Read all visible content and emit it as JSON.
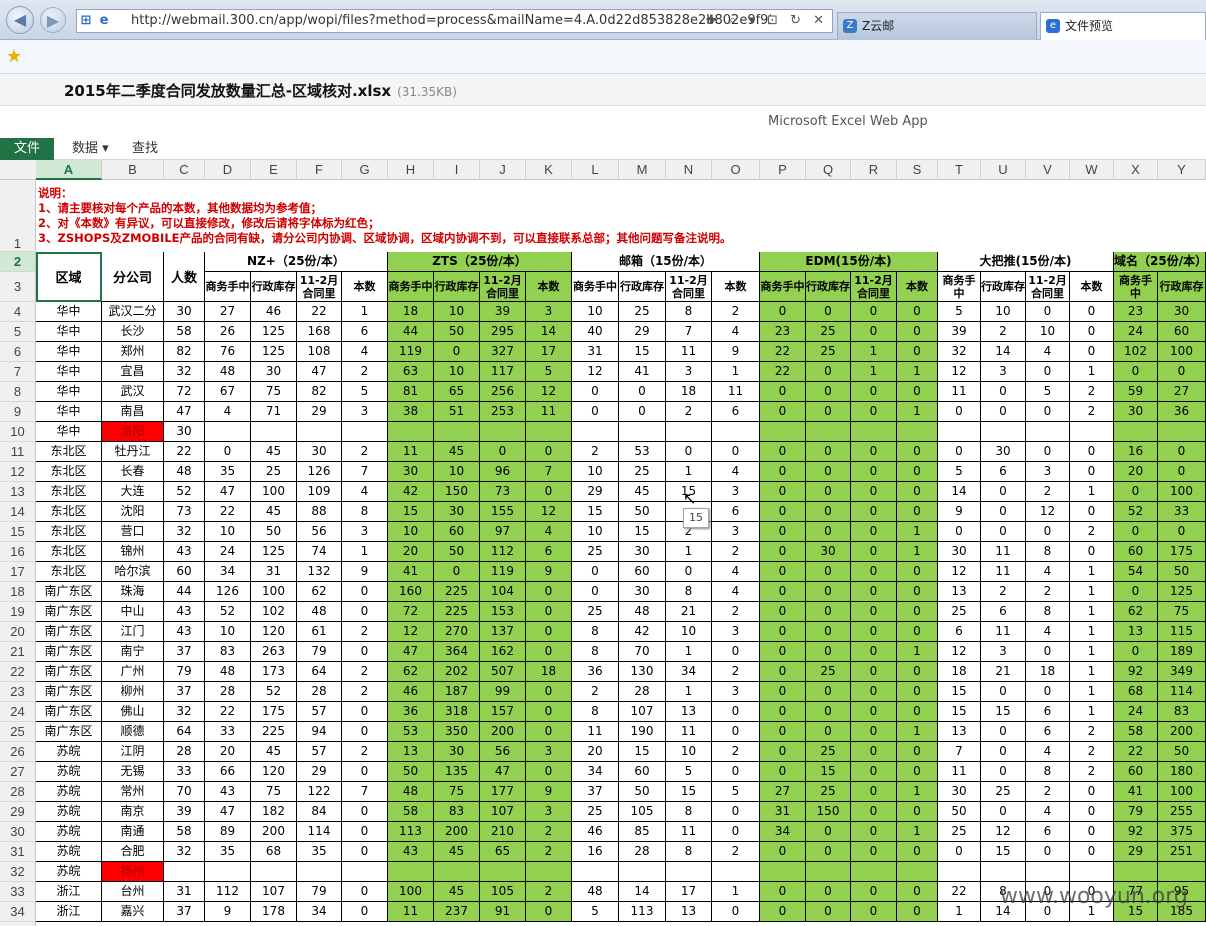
{
  "browser": {
    "back_glyph": "◀",
    "forward_glyph": "▶",
    "url": "http://webmail.300.cn/app/wopi/files?method=process&mailName=4.A.0d22d853828e2b802e9f93a95",
    "addr_tools": "✚ ⌕ ▾ ⊡ ↻ ✕",
    "tabs": [
      {
        "title": "Z云邮",
        "icon": "Z"
      },
      {
        "title": "文件预览",
        "icon": "e"
      }
    ],
    "favorites_icon": "★"
  },
  "file": {
    "name": "2015年二季度合同发放数量汇总-区域核对.xlsx",
    "size": "(31.35KB)"
  },
  "app": {
    "name": "Microsoft Excel Web App",
    "menu": {
      "file": "文件",
      "data": "数据 ▾",
      "find": "查找"
    }
  },
  "sheet": {
    "columns": [
      "A",
      "B",
      "C",
      "D",
      "E",
      "F",
      "G",
      "H",
      "I",
      "J",
      "K",
      "L",
      "M",
      "N",
      "O",
      "P",
      "Q",
      "R",
      "S",
      "T",
      "U",
      "V",
      "W",
      "X",
      "Y"
    ],
    "rows": [
      "1",
      "2",
      "3",
      "4",
      "5",
      "6",
      "7",
      "8",
      "9",
      "10",
      "11",
      "12",
      "13",
      "14",
      "15",
      "16",
      "17",
      "18",
      "19",
      "20",
      "21",
      "22",
      "23",
      "24",
      "25",
      "26",
      "27",
      "28",
      "29",
      "30",
      "31",
      "32",
      "33",
      "34"
    ],
    "notes": [
      "说明：",
      "1、请主要核对每个产品的本数，其他数据均为参考值；",
      "2、对《本数》有异议，可以直接修改，修改后请将字体标为红色；",
      "3、ZSHOPS及ZMOBILE产品的合同有缺，请分公司内协调、区域协调，区域内协调不到，可以直接联系总部；其他问题写备注说明。"
    ],
    "header": {
      "region": "区域",
      "branch": "分公司",
      "people": "人数",
      "groups": [
        "NZ+（25份/本）",
        "ZTS（25份/本）",
        "邮箱（15份/本）",
        "EDM(15份/本)",
        "大把推(15份/本)",
        "域名（25份/本）"
      ],
      "sub": [
        "商务手中",
        "行政库存",
        "11-2月合同里",
        "本数"
      ]
    },
    "data": [
      [
        "华中",
        "武汉二分",
        "30",
        "27",
        "46",
        "22",
        "1",
        "18",
        "10",
        "39",
        "3",
        "10",
        "25",
        "8",
        "2",
        "0",
        "0",
        "0",
        "0",
        "5",
        "10",
        "0",
        "0",
        "23",
        "30"
      ],
      [
        "华中",
        "长沙",
        "58",
        "26",
        "125",
        "168",
        "6",
        "44",
        "50",
        "295",
        "14",
        "40",
        "29",
        "7",
        "4",
        "23",
        "25",
        "0",
        "0",
        "39",
        "2",
        "10",
        "0",
        "24",
        "60"
      ],
      [
        "华中",
        "郑州",
        "82",
        "76",
        "125",
        "108",
        "4",
        "119",
        "0",
        "327",
        "17",
        "31",
        "15",
        "11",
        "9",
        "22",
        "25",
        "1",
        "0",
        "32",
        "14",
        "4",
        "0",
        "102",
        "100"
      ],
      [
        "华中",
        "宜昌",
        "32",
        "48",
        "30",
        "47",
        "2",
        "63",
        "10",
        "117",
        "5",
        "12",
        "41",
        "3",
        "1",
        "22",
        "0",
        "1",
        "1",
        "12",
        "3",
        "0",
        "1",
        "0",
        "0"
      ],
      [
        "华中",
        "武汉",
        "72",
        "67",
        "75",
        "82",
        "5",
        "81",
        "65",
        "256",
        "12",
        "0",
        "0",
        "18",
        "11",
        "0",
        "0",
        "0",
        "0",
        "11",
        "0",
        "5",
        "2",
        "59",
        "27"
      ],
      [
        "华中",
        "南昌",
        "47",
        "4",
        "71",
        "29",
        "3",
        "38",
        "51",
        "253",
        "11",
        "0",
        "0",
        "2",
        "6",
        "0",
        "0",
        "0",
        "1",
        "0",
        "0",
        "0",
        "2",
        "30",
        "36"
      ],
      [
        "华中",
        "洛阳",
        "30",
        "",
        "",
        "",
        "",
        "",
        "",
        "",
        "",
        "",
        "",
        "",
        "",
        "",
        "",
        "",
        "",
        "",
        "",
        "",
        "",
        "",
        ""
      ],
      [
        "东北区",
        "牡丹江",
        "22",
        "0",
        "45",
        "30",
        "2",
        "11",
        "45",
        "0",
        "0",
        "2",
        "53",
        "0",
        "0",
        "0",
        "0",
        "0",
        "0",
        "0",
        "30",
        "0",
        "0",
        "16",
        "0"
      ],
      [
        "东北区",
        "长春",
        "48",
        "35",
        "25",
        "126",
        "7",
        "30",
        "10",
        "96",
        "7",
        "10",
        "25",
        "1",
        "4",
        "0",
        "0",
        "0",
        "0",
        "5",
        "6",
        "3",
        "0",
        "20",
        "0"
      ],
      [
        "东北区",
        "大连",
        "52",
        "47",
        "100",
        "109",
        "4",
        "42",
        "150",
        "73",
        "0",
        "29",
        "45",
        "15",
        "3",
        "0",
        "0",
        "0",
        "0",
        "14",
        "0",
        "2",
        "1",
        "0",
        "100"
      ],
      [
        "东北区",
        "沈阳",
        "73",
        "22",
        "45",
        "88",
        "8",
        "15",
        "30",
        "155",
        "12",
        "15",
        "50",
        "",
        "6",
        "0",
        "0",
        "0",
        "0",
        "9",
        "0",
        "12",
        "0",
        "52",
        "33"
      ],
      [
        "东北区",
        "营口",
        "32",
        "10",
        "50",
        "56",
        "3",
        "10",
        "60",
        "97",
        "4",
        "10",
        "15",
        "2",
        "3",
        "0",
        "0",
        "0",
        "1",
        "0",
        "0",
        "0",
        "2",
        "0",
        "0"
      ],
      [
        "东北区",
        "锦州",
        "43",
        "24",
        "125",
        "74",
        "1",
        "20",
        "50",
        "112",
        "6",
        "25",
        "30",
        "1",
        "2",
        "0",
        "30",
        "0",
        "1",
        "30",
        "11",
        "8",
        "0",
        "60",
        "175"
      ],
      [
        "东北区",
        "哈尔滨",
        "60",
        "34",
        "31",
        "132",
        "9",
        "41",
        "0",
        "119",
        "9",
        "0",
        "60",
        "0",
        "4",
        "0",
        "0",
        "0",
        "0",
        "12",
        "11",
        "4",
        "1",
        "54",
        "50"
      ],
      [
        "南广东区",
        "珠海",
        "44",
        "126",
        "100",
        "62",
        "0",
        "160",
        "225",
        "104",
        "0",
        "0",
        "30",
        "8",
        "4",
        "0",
        "0",
        "0",
        "0",
        "13",
        "2",
        "2",
        "1",
        "0",
        "125"
      ],
      [
        "南广东区",
        "中山",
        "43",
        "52",
        "102",
        "48",
        "0",
        "72",
        "225",
        "153",
        "0",
        "25",
        "48",
        "21",
        "2",
        "0",
        "0",
        "0",
        "0",
        "25",
        "6",
        "8",
        "1",
        "62",
        "75"
      ],
      [
        "南广东区",
        "江门",
        "43",
        "10",
        "120",
        "61",
        "2",
        "12",
        "270",
        "137",
        "0",
        "8",
        "42",
        "10",
        "3",
        "0",
        "0",
        "0",
        "0",
        "6",
        "11",
        "4",
        "1",
        "13",
        "115"
      ],
      [
        "南广东区",
        "南宁",
        "37",
        "83",
        "263",
        "79",
        "0",
        "47",
        "364",
        "162",
        "0",
        "8",
        "70",
        "1",
        "0",
        "0",
        "0",
        "0",
        "1",
        "12",
        "3",
        "0",
        "1",
        "0",
        "189"
      ],
      [
        "南广东区",
        "广州",
        "79",
        "48",
        "173",
        "64",
        "2",
        "62",
        "202",
        "507",
        "18",
        "36",
        "130",
        "34",
        "2",
        "0",
        "25",
        "0",
        "0",
        "18",
        "21",
        "18",
        "1",
        "92",
        "349"
      ],
      [
        "南广东区",
        "柳州",
        "37",
        "28",
        "52",
        "28",
        "2",
        "46",
        "187",
        "99",
        "0",
        "2",
        "28",
        "1",
        "3",
        "0",
        "0",
        "0",
        "0",
        "15",
        "0",
        "0",
        "1",
        "68",
        "114"
      ],
      [
        "南广东区",
        "佛山",
        "32",
        "22",
        "175",
        "57",
        "0",
        "36",
        "318",
        "157",
        "0",
        "8",
        "107",
        "13",
        "0",
        "0",
        "0",
        "0",
        "0",
        "15",
        "15",
        "6",
        "1",
        "24",
        "83"
      ],
      [
        "南广东区",
        "顺德",
        "64",
        "33",
        "225",
        "94",
        "0",
        "53",
        "350",
        "200",
        "0",
        "11",
        "190",
        "11",
        "0",
        "0",
        "0",
        "0",
        "1",
        "13",
        "0",
        "6",
        "2",
        "58",
        "200"
      ],
      [
        "苏皖",
        "江阴",
        "28",
        "20",
        "45",
        "57",
        "2",
        "13",
        "30",
        "56",
        "3",
        "20",
        "15",
        "10",
        "2",
        "0",
        "25",
        "0",
        "0",
        "7",
        "0",
        "4",
        "2",
        "22",
        "50"
      ],
      [
        "苏皖",
        "无锡",
        "33",
        "66",
        "120",
        "29",
        "0",
        "50",
        "135",
        "47",
        "0",
        "34",
        "60",
        "5",
        "0",
        "0",
        "15",
        "0",
        "0",
        "11",
        "0",
        "8",
        "2",
        "60",
        "180"
      ],
      [
        "苏皖",
        "常州",
        "70",
        "43",
        "75",
        "122",
        "7",
        "48",
        "75",
        "177",
        "9",
        "37",
        "50",
        "15",
        "5",
        "27",
        "25",
        "0",
        "1",
        "30",
        "25",
        "2",
        "0",
        "41",
        "100"
      ],
      [
        "苏皖",
        "南京",
        "39",
        "47",
        "182",
        "84",
        "0",
        "58",
        "83",
        "107",
        "3",
        "25",
        "105",
        "8",
        "0",
        "31",
        "150",
        "0",
        "0",
        "50",
        "0",
        "4",
        "0",
        "79",
        "255"
      ],
      [
        "苏皖",
        "南通",
        "58",
        "89",
        "200",
        "114",
        "0",
        "113",
        "200",
        "210",
        "2",
        "46",
        "85",
        "11",
        "0",
        "34",
        "0",
        "0",
        "1",
        "25",
        "12",
        "6",
        "0",
        "92",
        "375"
      ],
      [
        "苏皖",
        "合肥",
        "32",
        "35",
        "68",
        "35",
        "0",
        "43",
        "45",
        "65",
        "2",
        "16",
        "28",
        "8",
        "2",
        "0",
        "0",
        "0",
        "0",
        "0",
        "15",
        "0",
        "0",
        "29",
        "251"
      ],
      [
        "苏皖",
        "扬州",
        "",
        "",
        "",
        "",
        "",
        "",
        "",
        "",
        "",
        "",
        "",
        "",
        "",
        "",
        "",
        "",
        "",
        "",
        "",
        "",
        "",
        "",
        ""
      ],
      [
        "浙江",
        "台州",
        "31",
        "112",
        "107",
        "79",
        "0",
        "100",
        "45",
        "105",
        "2",
        "48",
        "14",
        "17",
        "1",
        "0",
        "0",
        "0",
        "0",
        "22",
        "8",
        "0",
        "0",
        "77",
        "95"
      ],
      [
        "浙江",
        "嘉兴",
        "37",
        "9",
        "178",
        "34",
        "0",
        "11",
        "237",
        "91",
        "0",
        "5",
        "113",
        "13",
        "0",
        "0",
        "0",
        "0",
        "0",
        "1",
        "14",
        "0",
        "1",
        "15",
        "185"
      ]
    ],
    "red_cells": [
      6,
      28
    ],
    "tooltip": "15"
  },
  "watermark": "www.wooyun.org",
  "colors": {
    "green": "#92d050",
    "red": "#ff0000",
    "excel": "#217346"
  }
}
